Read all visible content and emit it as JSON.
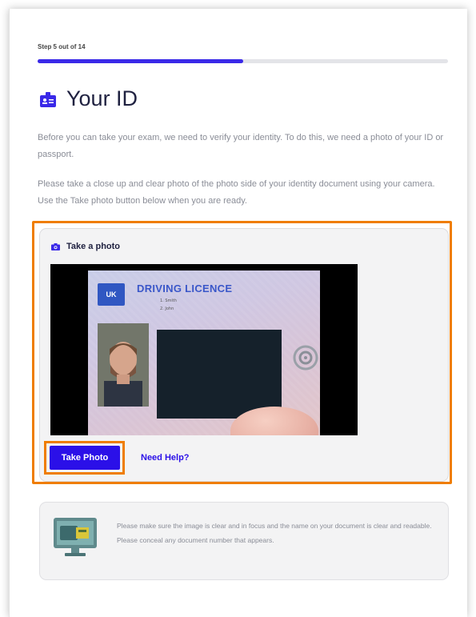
{
  "step": {
    "label": "Step 5 out of 14",
    "progress_fraction": 0.5
  },
  "header": {
    "title": "Your ID",
    "icon": "id-badge-icon"
  },
  "intro": {
    "paragraph1": "Before you can take your exam, we need to verify your identity. To do this, we need a photo of your ID or passport.",
    "paragraph2": "Please take a close up and clear photo of the photo side of your identity document using your camera. Use the Take photo button below when you are ready."
  },
  "photo_card": {
    "title": "Take a photo",
    "icon": "camera-icon",
    "camera_preview": {
      "document_title": "DRIVING LICENCE",
      "country_code": "UK",
      "line1": "1. Smith",
      "line2": "2. John"
    },
    "take_photo_label": "Take Photo",
    "help_label": "Need Help?"
  },
  "tip_card": {
    "icon": "monitor-document-icon",
    "text": "Please make sure the image is clear and in focus and the name on your document is clear and readable. Please conceal any document number that appears."
  },
  "colors": {
    "accent": "#2b10e8",
    "highlight": "#ef7d00",
    "card_bg": "#f3f3f4"
  }
}
